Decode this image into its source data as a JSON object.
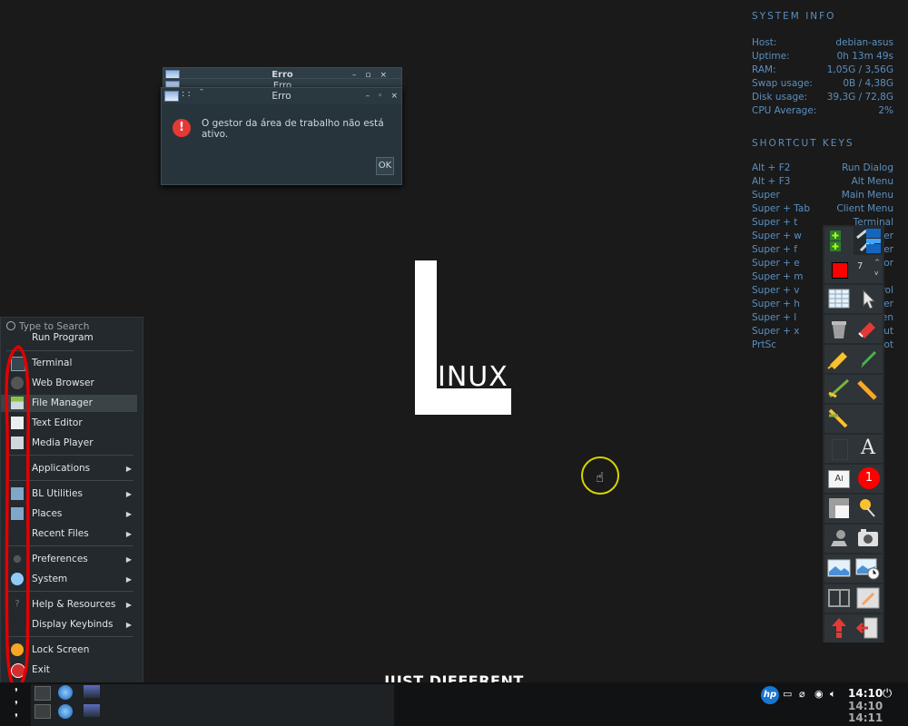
{
  "sysinfo": {
    "header": "SYSTEM INFO",
    "rows": [
      {
        "k": "Host:",
        "v": "debian-asus"
      },
      {
        "k": "Uptime:",
        "v": "0h 13m 49s"
      },
      {
        "k": "RAM:",
        "v": "1,05G / 3,56G"
      },
      {
        "k": "Swap usage:",
        "v": "0B / 4,38G"
      },
      {
        "k": "Disk usage:",
        "v": "39,3G / 72,8G"
      },
      {
        "k": "CPU Average:",
        "v": "2%"
      }
    ],
    "shortcuts_header": "SHORTCUT KEYS",
    "shortcuts": [
      {
        "k": "Alt + F2",
        "v": "Run Dialog"
      },
      {
        "k": "Alt + F3",
        "v": "Alt Menu"
      },
      {
        "k": "Super",
        "v": "Main Menu"
      },
      {
        "k": "Super + Tab",
        "v": "Client Menu"
      },
      {
        "k": "Super + t",
        "v": "Terminal"
      },
      {
        "k": "Super + w",
        "v": "er"
      },
      {
        "k": "Super + f",
        "v": "er"
      },
      {
        "k": "Super + e",
        "v": "or"
      },
      {
        "k": "Super + m",
        "v": ""
      },
      {
        "k": "Super + v",
        "v": "rol"
      },
      {
        "k": "Super + h",
        "v": "er"
      },
      {
        "k": "Super + l",
        "v": "en"
      },
      {
        "k": "Super + x",
        "v": "ut"
      },
      {
        "k": "PrtSc",
        "v": "ot"
      }
    ]
  },
  "dialogs": {
    "stack_titles": [
      "Erro",
      "Erro"
    ],
    "title": "Erro",
    "message": "O gestor da área de trabalho não está ativo.",
    "ok": "OK"
  },
  "logo": {
    "text": "INUX",
    "tagline": "JUST DIFFERENT"
  },
  "menu": {
    "search_placeholder": "Type to Search",
    "run": "Run Program",
    "items": [
      {
        "label": "Terminal",
        "icon": "terminal-icon",
        "arrow": false
      },
      {
        "label": "Web Browser",
        "icon": "web-browser-icon",
        "arrow": false
      },
      {
        "label": "File Manager",
        "icon": "file-manager-icon",
        "arrow": false
      },
      {
        "label": "Text Editor",
        "icon": "text-editor-icon",
        "arrow": false
      },
      {
        "label": "Media Player",
        "icon": "media-player-icon",
        "arrow": false
      },
      {
        "label": "Applications",
        "icon": "",
        "arrow": true
      },
      {
        "label": "BL Utilities",
        "icon": "folder-icon",
        "arrow": true
      },
      {
        "label": "Places",
        "icon": "folder-icon",
        "arrow": true
      },
      {
        "label": "Recent Files",
        "icon": "",
        "arrow": true
      },
      {
        "label": "Preferences",
        "icon": "preferences-icon",
        "arrow": true
      },
      {
        "label": "System",
        "icon": "system-gear-icon",
        "arrow": true
      },
      {
        "label": "Help & Resources",
        "icon": "help-icon",
        "arrow": true
      },
      {
        "label": "Display Keybinds",
        "icon": "",
        "arrow": true
      },
      {
        "label": "Lock Screen",
        "icon": "lock-icon",
        "arrow": false
      },
      {
        "label": "Exit",
        "icon": "exit-icon",
        "arrow": false
      }
    ]
  },
  "palette": {
    "colors": {
      "red": "#ff0000"
    },
    "spin_value": "7",
    "badge": "1"
  },
  "tray": {
    "clock": "14:10",
    "clock2": "14:10",
    "clock3": "14:11"
  }
}
